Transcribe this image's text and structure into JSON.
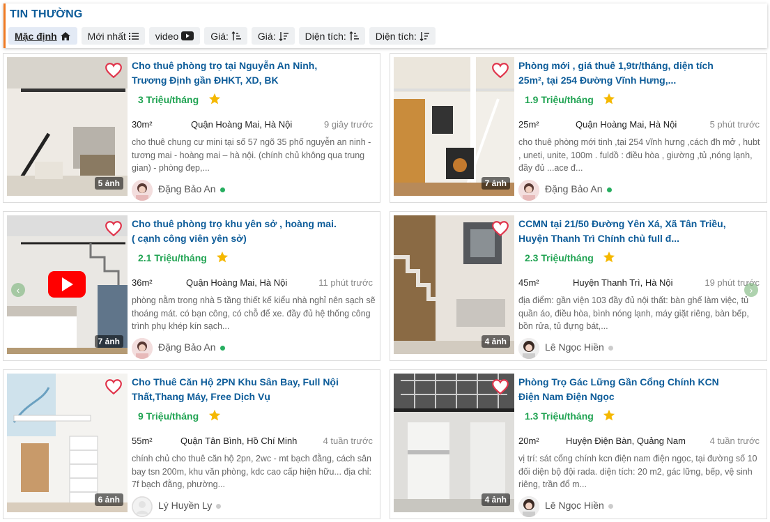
{
  "section": {
    "title": "TIN THƯỜNG"
  },
  "filters": [
    {
      "label": "Mặc định",
      "icon": "home-icon",
      "active": true
    },
    {
      "label": "Mới nhất",
      "icon": "list-icon"
    },
    {
      "label": "video",
      "icon": "youtube-icon"
    },
    {
      "label": "Giá:",
      "icon": "sort-asc-icon"
    },
    {
      "label": "Giá:",
      "icon": "sort-desc-icon"
    },
    {
      "label": "Diện tích:",
      "icon": "sort-asc-icon"
    },
    {
      "label": "Diện tích:",
      "icon": "sort-desc-icon"
    }
  ],
  "listings": [
    {
      "title": "Cho thuê phòng trọ tại Nguyễn An Ninh, Trương Định gần ĐHKT, XD, BK",
      "price": "3 Triệu/tháng",
      "area": "30m²",
      "location": "Quận Hoàng Mai, Hà Nội",
      "time": "9 giây trước",
      "description": "cho thuê chung cư mini tại số 57 ngõ 35 phố nguyễn an ninh - tương mai - hoàng mai – hà nội. (chính chủ không qua trung gian) - phòng đẹp,...",
      "photos": "5 ảnh",
      "user": "Đặng Bảo An",
      "online": true
    },
    {
      "title": "Phòng mới , giá thuê 1,9tr/tháng, diện tích 25m², tại 254 Đường Vĩnh Hưng,...",
      "price": "1.9 Triệu/tháng",
      "area": "25m²",
      "location": "Quận Hoàng Mai, Hà Nội",
      "time": "5 phút trước",
      "description": "cho thuê phòng mới tinh ,tại 254 vĩnh hưng ,cách đh mở , hubt , uneti, unite, 100m . fuldồ : điều hòa , giường ,tủ ,nóng lạnh, đầy đủ ...ace đ...",
      "photos": "7 ảnh",
      "user": "Đặng Bảo An",
      "online": true
    },
    {
      "title": "Cho thuê phòng trọ khu yên sở , hoàng mai. ( cạnh công viên yên sở)",
      "price": "2.1 Triệu/tháng",
      "area": "36m²",
      "location": "Quận Hoàng Mai, Hà Nội",
      "time": "11 phút trước",
      "description": "phòng nằm trong nhà 5 tầng thiết kế kiểu nhà nghỉ nên sạch sẽ thoáng mát. có bạn công, có chỗ để xe. đầy đủ hệ thống công trình phụ khép kín sạch...",
      "photos": "7 ảnh",
      "user": "Đặng Bảo An",
      "online": true
    },
    {
      "title": "CCMN tại 21/50 Đường Yên Xá, Xã Tân Triều, Huyện Thanh Trì Chính chủ full đ...",
      "price": "2.3 Triệu/tháng",
      "area": "45m²",
      "location": "Huyện Thanh Trì, Hà Nội",
      "time": "19 phút trước",
      "description": "địa điểm: gần viện 103 đầy đủ nội thất: bàn ghế làm việc, tủ quần áo, điều hòa, bình nóng lạnh, máy giặt riêng, bàn bếp, bồn rửa, tủ đựng bát,...",
      "photos": "4 ảnh",
      "user": "Lê Ngọc Hiền",
      "online": false
    },
    {
      "title": "Cho Thuê Căn Hộ 2PN Khu Sân Bay, Full Nội Thất,Thang Máy, Free Dịch Vụ",
      "price": "9 Triệu/tháng",
      "area": "55m²",
      "location": "Quận Tân Bình, Hồ Chí Minh",
      "time": "4 tuần trước",
      "description": "chính chủ cho thuê căn hộ 2pn, 2wc - mt bạch đằng, cách sân bay tsn 200m, khu văn phòng, kdc cao cấp hiện hữu... địa chỉ: 7f bạch đằng, phường...",
      "photos": "6 ảnh",
      "user": "Lý Huyền Ly",
      "online": false
    },
    {
      "title": "Phòng Trọ Gác Lững Gần Cổng Chính KCN Điện Nam Điện Ngọc",
      "price": "1.3 Triệu/tháng",
      "area": "20m²",
      "location": "Huyện Điện Bàn, Quảng Nam",
      "time": "4 tuần trước",
      "description": "vị trí: sát cổng chính kcn điện nam điện ngọc, tại đường số 10 đối diện bộ đội rada. diện tích: 20 m2, gác lững, bếp, vệ sinh riêng, trần đổ m...",
      "photos": "4 ảnh",
      "user": "Lê Ngọc Hiền",
      "online": false
    }
  ],
  "colors": {
    "title": "#0d5c99",
    "price": "#20a352",
    "accent": "#f07a22",
    "heart": "#e0344b",
    "star": "#f5b800",
    "online": "#27ae60",
    "offline": "#cccccc"
  }
}
